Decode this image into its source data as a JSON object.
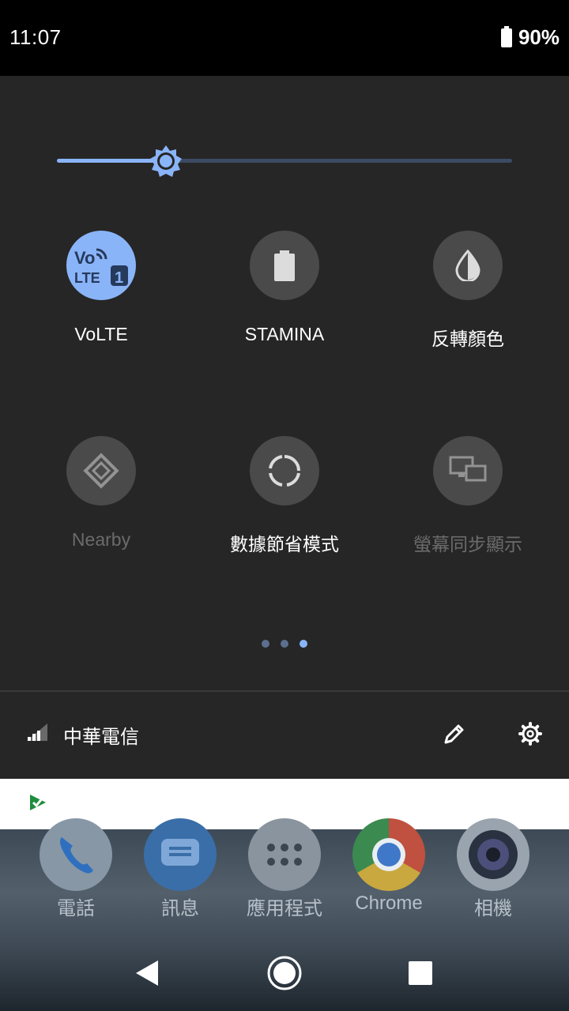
{
  "status": {
    "time": "11:07",
    "battery": "90%"
  },
  "brightness": {
    "level": 0.24
  },
  "tiles": [
    {
      "label": "VoLTE",
      "icon": "volte-icon",
      "state": "on"
    },
    {
      "label": "STAMINA",
      "icon": "battery-icon",
      "state": "off"
    },
    {
      "label": "反轉顏色",
      "icon": "invert-colors-icon",
      "state": "off"
    },
    {
      "label": "Nearby",
      "icon": "nearby-icon",
      "state": "unavailable"
    },
    {
      "label": "數據節省模式",
      "icon": "data-saver-icon",
      "state": "off"
    },
    {
      "label": "螢幕同步顯示",
      "icon": "screen-cast-icon",
      "state": "unavailable"
    }
  ],
  "pager": {
    "pages": 3,
    "current": 3
  },
  "footer": {
    "carrier": "中華電信"
  },
  "dock": [
    {
      "label": "電話",
      "icon": "phone-icon"
    },
    {
      "label": "訊息",
      "icon": "messages-icon"
    },
    {
      "label": "應用程式",
      "icon": "apps-icon"
    },
    {
      "label": "Chrome",
      "icon": "chrome-icon"
    },
    {
      "label": "相機",
      "icon": "camera-icon"
    }
  ],
  "colors": {
    "accent": "#8ab4f8",
    "panel": "#262626",
    "tile_off": "#4a4a4a"
  }
}
